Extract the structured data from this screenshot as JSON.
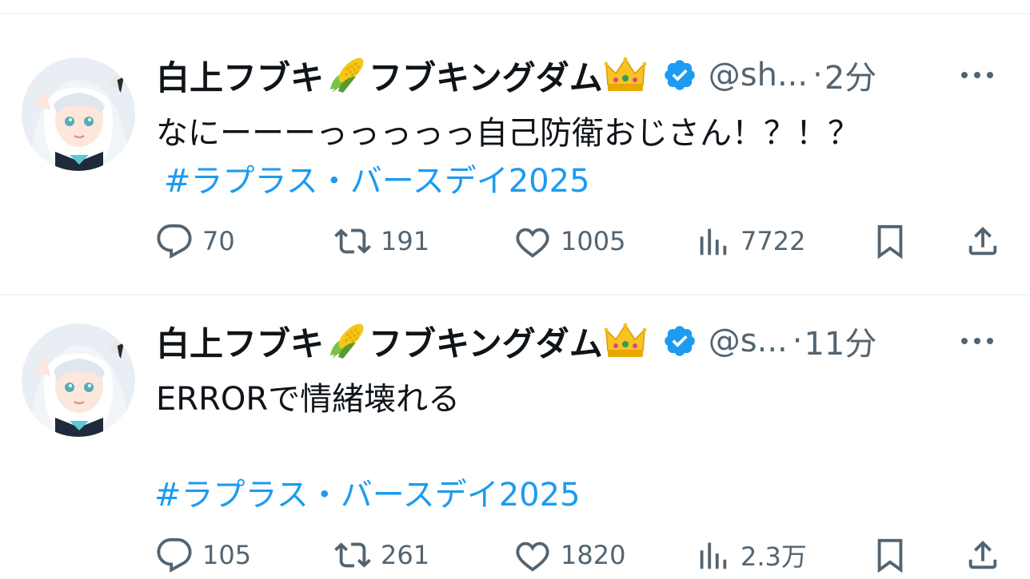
{
  "tweets": [
    {
      "display_name": "白上フブキ",
      "display_name_suffix": "フブキングダム",
      "handle": "@sh...",
      "separator": "·",
      "time": "2分",
      "text": "なにーーーっっっっっ自己防衛おじさん！？！？",
      "hashtag": "#ラプラス・バースデイ2025",
      "replies": "70",
      "retweets": "191",
      "likes": "1005",
      "views": "7722"
    },
    {
      "display_name": "白上フブキ",
      "display_name_suffix": "フブキングダム",
      "handle": "@s...",
      "separator": "·",
      "time": "11分",
      "text": "ERRORで情緒壊れる",
      "hashtag": "#ラプラス・バースデイ2025",
      "replies": "105",
      "retweets": "261",
      "likes": "1820",
      "views": "2.3万"
    }
  ],
  "icons": {
    "emoji_1": "corn-emoji",
    "emoji_2": "crown-emoji",
    "verified": "verified-badge-icon",
    "more": "more-icon",
    "reply": "reply-icon",
    "retweet": "retweet-icon",
    "like": "like-icon",
    "views": "views-icon",
    "bookmark": "bookmark-icon",
    "share": "share-icon"
  },
  "colors": {
    "text": "#0f1419",
    "secondary": "#536471",
    "link": "#1d9bf0",
    "divider": "#eff3f4"
  }
}
